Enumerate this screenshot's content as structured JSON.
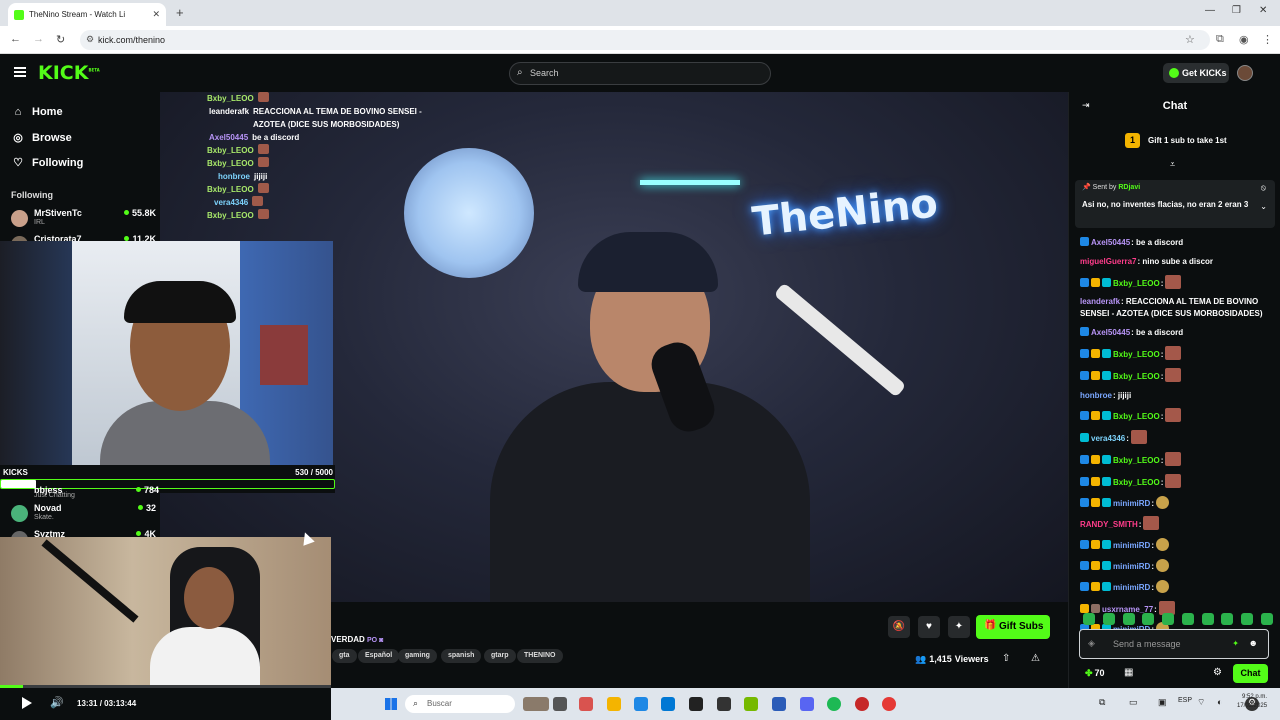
{
  "browser": {
    "tab_title": "TheNino Stream - Watch Li",
    "tab_close": "✕",
    "new_tab": "+",
    "url": "kick.com/thenino",
    "window_controls": [
      "—",
      "❐",
      "✕"
    ]
  },
  "header": {
    "logo": "KICK",
    "logo_badge": "BETA",
    "search_placeholder": "Search",
    "get_kicks_label": "Get KICKs"
  },
  "sidebar": {
    "nav": [
      {
        "label": "Home",
        "icon": "home-icon"
      },
      {
        "label": "Browse",
        "icon": "compass-icon"
      },
      {
        "label": "Following",
        "icon": "heart-icon"
      }
    ],
    "following_heading": "Following",
    "channels": [
      {
        "name": "MrStivenTc",
        "category": "IRL",
        "viewers": "55.8K",
        "color": "#c9a08a"
      },
      {
        "name": "Cristorata7",
        "category": "",
        "viewers": "11.2K",
        "color": "#7a6a5a"
      },
      {
        "name": "bbjess",
        "category": "Just Chatting",
        "viewers": "784",
        "color": "#b58b72"
      },
      {
        "name": "Novad",
        "category": "Skate.",
        "viewers": "32",
        "color": "#4ab37a"
      },
      {
        "name": "Syztmz",
        "category": "",
        "viewers": "4K",
        "color": "#666"
      }
    ],
    "pip_label": "Just Chatting"
  },
  "video_overlay_chat": [
    {
      "user": "Bxby_LEOO",
      "text": ""
    },
    {
      "user": "leanderafk",
      "text": "REACCIONA AL TEMA DE BOVINO SENSEI - AZOTEA (DICE SUS MORBOSIDADES)"
    },
    {
      "user": "Axel50445",
      "text": "be a discord"
    },
    {
      "user": "Bxby_LEOO",
      "text": ""
    },
    {
      "user": "Bxby_LEOO",
      "text": ""
    },
    {
      "user": "honbroe",
      "text": "jijiji"
    },
    {
      "user": "Bxby_LEOO",
      "text": ""
    },
    {
      "user": "vera4346",
      "text": ""
    },
    {
      "user": "Bxby_LEOO",
      "text": ""
    },
    {
      "user": "Bxby_LEOO",
      "text": ""
    }
  ],
  "stream_overlay": {
    "neon_sign": "TheNino",
    "kicks_label": "KICKS",
    "kicks_count": "530",
    "kicks_separator": "/",
    "kicks_goal": "5000",
    "kicks_progress": 0.106
  },
  "stream_info": {
    "title_fragment": "VERDAD",
    "tags": [
      "gta",
      "Español",
      "gaming",
      "spanish",
      "gtarp",
      "THENINO"
    ],
    "gift_subs_label": "Gift Subs",
    "viewers": "1,415",
    "viewers_label": "Viewers"
  },
  "player": {
    "current_time": "13:31",
    "duration": "03:13:44",
    "progress": 0.07
  },
  "chat": {
    "title": "Chat",
    "gift_rank": "1",
    "gift_prompt": "Gift 1 sub to take 1st",
    "pinned": {
      "sent_by_label": "Sent by",
      "sender": "RDjavi",
      "message": "Asi no, no inventes flacias, no eran 2 eran 3"
    },
    "messages": [
      {
        "user": "Axel50445",
        "color": "#b794f6",
        "text": ": be a discord",
        "badges": [
          "#1e88e5"
        ]
      },
      {
        "user": "miguelGuerra7",
        "color": "#ff3d8b",
        "text": ": nino sube a discor",
        "badges": []
      },
      {
        "user": "Bxby_LEOO",
        "color": "#53fc18",
        "text": ":",
        "badges": [
          "#1e88e5",
          "#f4b400",
          "#00bcd4"
        ],
        "emote": true
      },
      {
        "user": "leanderafk",
        "color": "#b794f6",
        "text": ": REACCIONA AL TEMA DE BOVINO SENSEI - AZOTEA (DICE SUS MORBOSIDADES)",
        "badges": []
      },
      {
        "user": "Axel50445",
        "color": "#b794f6",
        "text": ": be a discord",
        "badges": [
          "#1e88e5"
        ]
      },
      {
        "user": "Bxby_LEOO",
        "color": "#53fc18",
        "text": ":",
        "badges": [
          "#1e88e5",
          "#f4b400",
          "#00bcd4"
        ],
        "emote": true
      },
      {
        "user": "Bxby_LEOO",
        "color": "#53fc18",
        "text": ":",
        "badges": [
          "#1e88e5",
          "#f4b400",
          "#00bcd4"
        ],
        "emote": true
      },
      {
        "user": "honbroe",
        "color": "#7aa7ff",
        "text": ": jijiji",
        "badges": []
      },
      {
        "user": "Bxby_LEOO",
        "color": "#53fc18",
        "text": ":",
        "badges": [
          "#1e88e5",
          "#f4b400",
          "#00bcd4"
        ],
        "emote": true
      },
      {
        "user": "vera4346",
        "color": "#7dd3fc",
        "text": ":",
        "badges": [
          "#00bcd4"
        ],
        "emote": true
      },
      {
        "user": "Bxby_LEOO",
        "color": "#53fc18",
        "text": ":",
        "badges": [
          "#1e88e5",
          "#f4b400",
          "#00bcd4"
        ],
        "emote": true
      },
      {
        "user": "Bxby_LEOO",
        "color": "#53fc18",
        "text": ":",
        "badges": [
          "#1e88e5",
          "#f4b400",
          "#00bcd4"
        ],
        "emote": true
      },
      {
        "user": "minimiRD",
        "color": "#7aa7ff",
        "text": ":",
        "badges": [
          "#1e88e5",
          "#f4b400",
          "#00bcd4"
        ],
        "emote_round": true
      },
      {
        "user": "RANDY_SMITH",
        "color": "#ff3d8b",
        "text": ":",
        "badges": [],
        "emote": true
      },
      {
        "user": "minimiRD",
        "color": "#7aa7ff",
        "text": ":",
        "badges": [
          "#1e88e5",
          "#f4b400",
          "#00bcd4"
        ],
        "emote_round": true
      },
      {
        "user": "minimiRD",
        "color": "#7aa7ff",
        "text": ":",
        "badges": [
          "#1e88e5",
          "#f4b400",
          "#00bcd4"
        ],
        "emote_round": true
      },
      {
        "user": "minimiRD",
        "color": "#7aa7ff",
        "text": ":",
        "badges": [
          "#1e88e5",
          "#f4b400",
          "#00bcd4"
        ],
        "emote_round": true
      },
      {
        "user": "usxrname_77",
        "color": "#b794f6",
        "text": ":",
        "badges": [
          "#f4b400",
          "#8d6e63"
        ],
        "emote": true
      },
      {
        "user": "minimiRD",
        "color": "#7aa7ff",
        "text": ":",
        "badges": [
          "#1e88e5",
          "#f4b400",
          "#00bcd4"
        ],
        "emote_round": true
      }
    ],
    "input_placeholder": "Send a message",
    "points": "70",
    "send_label": "Chat"
  },
  "taskbar": {
    "search_placeholder": "Buscar",
    "lang": "ESP",
    "time": "9:52 p.m.",
    "date": "17/03/2025"
  },
  "colors": {
    "accent": "#53fc18",
    "background": "#0b0e0f"
  }
}
